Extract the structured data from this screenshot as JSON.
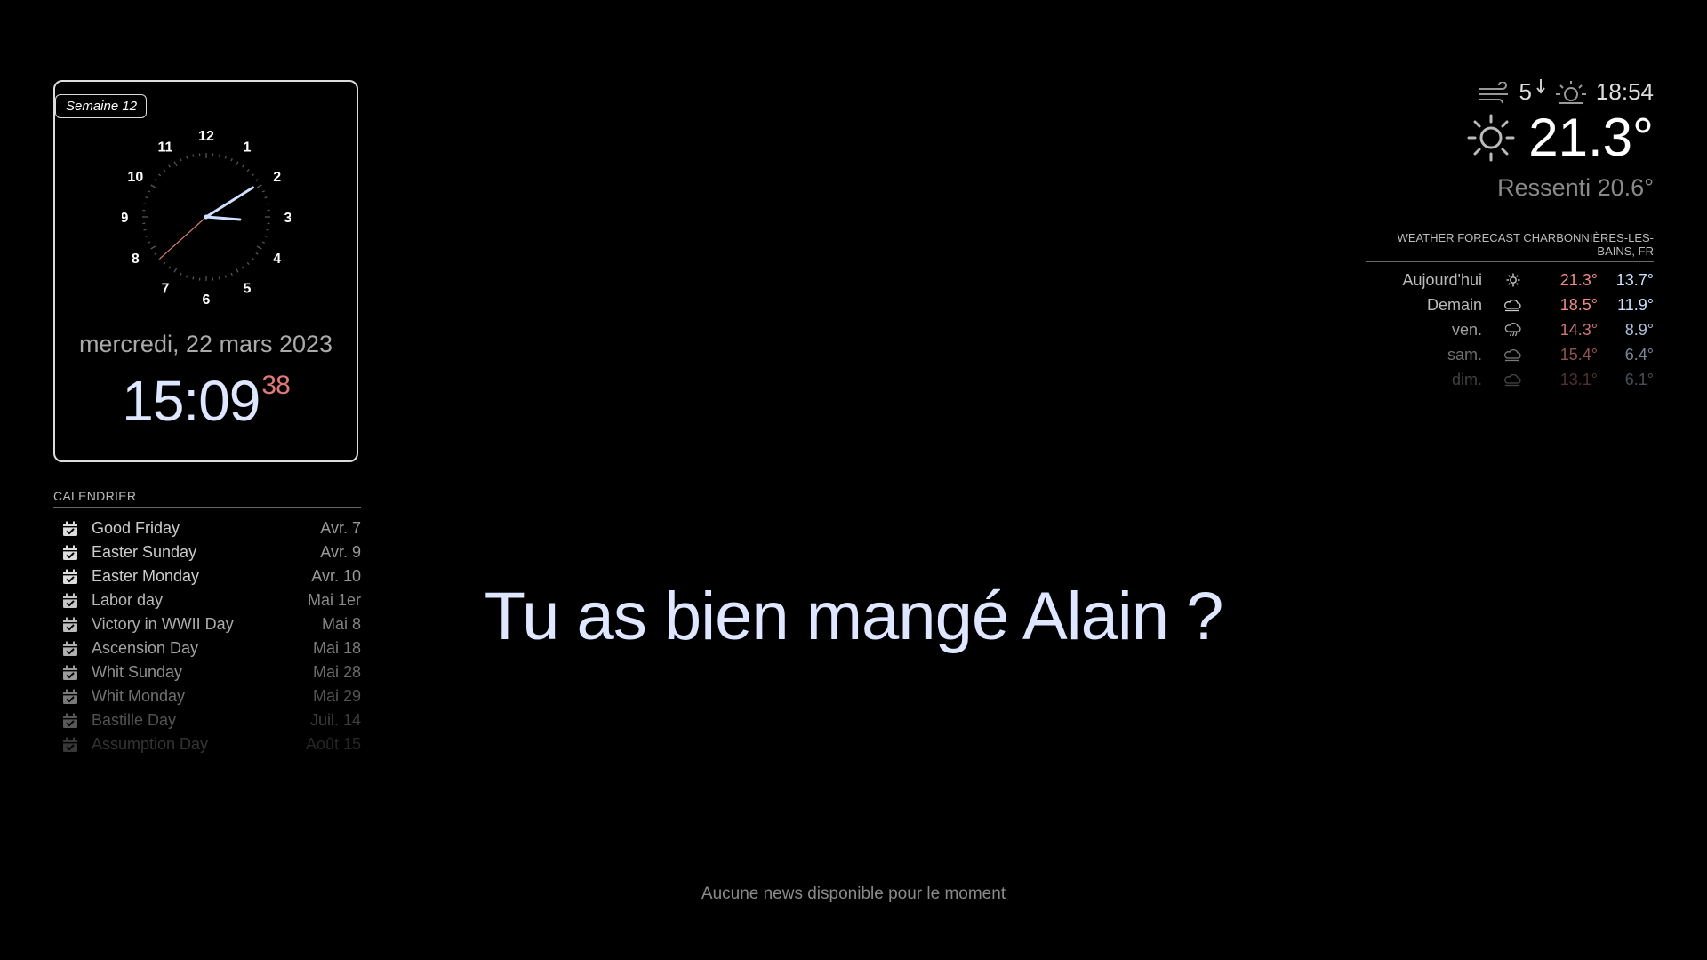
{
  "clock": {
    "week_label": "Semaine 12",
    "date": "mercredi, 22 mars 2023",
    "time_hm": "15:09",
    "time_sec": "38",
    "analog_numbers": [
      "12",
      "1",
      "2",
      "3",
      "4",
      "5",
      "6",
      "7",
      "8",
      "9",
      "10",
      "11"
    ],
    "analog_time": {
      "hour": 15,
      "minute": 9,
      "second": 38
    }
  },
  "calendar": {
    "header": "CALENDRIER",
    "icon": "calendar-check-icon",
    "events": [
      {
        "title": "Good Friday",
        "date": "Avr. 7"
      },
      {
        "title": "Easter Sunday",
        "date": "Avr. 9"
      },
      {
        "title": "Easter Monday",
        "date": "Avr. 10"
      },
      {
        "title": "Labor day",
        "date": "Mai 1er"
      },
      {
        "title": "Victory in WWII Day",
        "date": "Mai 8"
      },
      {
        "title": "Ascension Day",
        "date": "Mai 18"
      },
      {
        "title": "Whit Sunday",
        "date": "Mai 28"
      },
      {
        "title": "Whit Monday",
        "date": "Mai 29"
      },
      {
        "title": "Bastille Day",
        "date": "Juil. 14"
      },
      {
        "title": "Assumption Day",
        "date": "Août 15"
      }
    ]
  },
  "weather": {
    "wind_icon": "wind-icon",
    "wind_speed": "5",
    "wind_direction_icon": "arrow-down-icon",
    "sunset_icon": "sunset-icon",
    "sunset_time": "18:54",
    "condition_icon": "sun-icon",
    "temperature": "21.3°",
    "feels_like": "Ressenti 20.6°"
  },
  "forecast": {
    "header": "WEATHER FORECAST CHARBONNIÈRES-LES-BAINS, FR",
    "days": [
      {
        "day": "Aujourd'hui",
        "icon": "sun-icon",
        "max": "21.3°",
        "min": "13.7°"
      },
      {
        "day": "Demain",
        "icon": "cloud-sun-icon",
        "max": "18.5°",
        "min": "11.9°"
      },
      {
        "day": "ven.",
        "icon": "cloud-rain-icon",
        "max": "14.3°",
        "min": "8.9°"
      },
      {
        "day": "sam.",
        "icon": "cloud-sun-icon",
        "max": "15.4°",
        "min": "6.4°"
      },
      {
        "day": "dim.",
        "icon": "cloud-sun-icon",
        "max": "13.1°",
        "min": "6.1°"
      }
    ]
  },
  "compliment": "Tu as bien mangé Alain ?",
  "news": "Aucune news disponible pour le moment",
  "colors": {
    "background": "#000000",
    "hour_minute_hands": "#cfe0ff",
    "second_hand": "#e07a7a",
    "max_temp": "#f08a8a",
    "min_temp": "#cfe0ff"
  }
}
